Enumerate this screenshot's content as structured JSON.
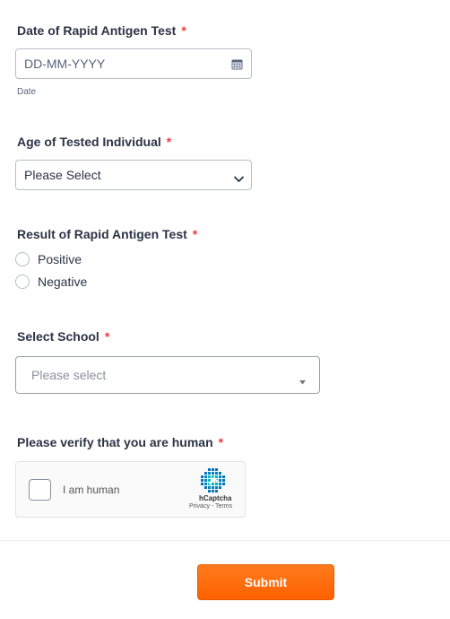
{
  "date_field": {
    "label": "Date of Rapid Antigen Test",
    "required_mark": "*",
    "placeholder": "DD-MM-YYYY",
    "sublabel": "Date",
    "icon": "calendar-icon"
  },
  "age_field": {
    "label": "Age of Tested Individual",
    "required_mark": "*",
    "selected": "Please Select",
    "icon": "chevron-down-icon"
  },
  "result_field": {
    "label": "Result of Rapid Antigen Test",
    "required_mark": "*",
    "options": [
      "Positive",
      "Negative"
    ]
  },
  "school_field": {
    "label": "Select School",
    "required_mark": "*",
    "placeholder": "Please select",
    "icon": "caret-down-icon"
  },
  "captcha": {
    "label": "Please verify that you are human",
    "required_mark": "*",
    "checkbox_text": "I am human",
    "brand": "hCaptcha",
    "links": "Privacy - Terms"
  },
  "submit": {
    "label": "Submit",
    "color": "#ff6100"
  },
  "colors": {
    "required": "#f23a3c",
    "text": "#2c3345",
    "border": "#b8bdc9"
  }
}
